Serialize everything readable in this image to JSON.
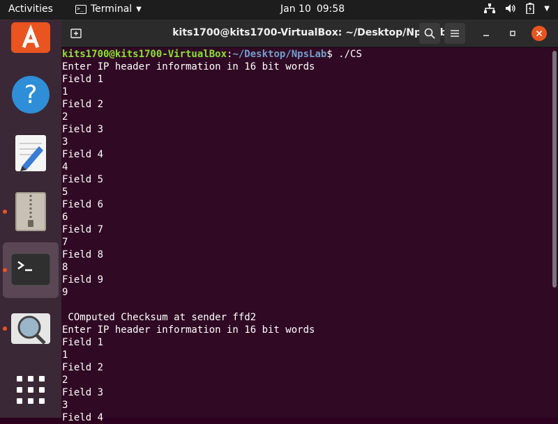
{
  "topbar": {
    "activities": "Activities",
    "app_name": "Terminal",
    "date": "Jan 10",
    "time": "09:58"
  },
  "window": {
    "title": "kits1700@kits1700-VirtualBox: ~/Desktop/NpsLab"
  },
  "prompt": {
    "user_host": "kits1700@kits1700-VirtualBox",
    "colon": ":",
    "path": "~/Desktop/NpsLab",
    "symbol": "$ ",
    "command": "./CS"
  },
  "terminal_lines": [
    "Enter IP header information in 16 bit words",
    "Field 1",
    "1",
    "Field 2",
    "2",
    "Field 3",
    "3",
    "Field 4",
    "4",
    "Field 5",
    "5",
    "Field 6",
    "6",
    "Field 7",
    "7",
    "Field 8",
    "8",
    "Field 9",
    "9",
    "",
    " COmputed Checksum at sender ffd2",
    "Enter IP header information in 16 bit words",
    "Field 1",
    "1",
    "Field 2",
    "2",
    "Field 3",
    "3",
    "Field 4"
  ],
  "colors": {
    "terminal_bg": "#300a24",
    "prompt_user": "#8ae234",
    "prompt_path": "#729fcf",
    "accent": "#e95420"
  }
}
